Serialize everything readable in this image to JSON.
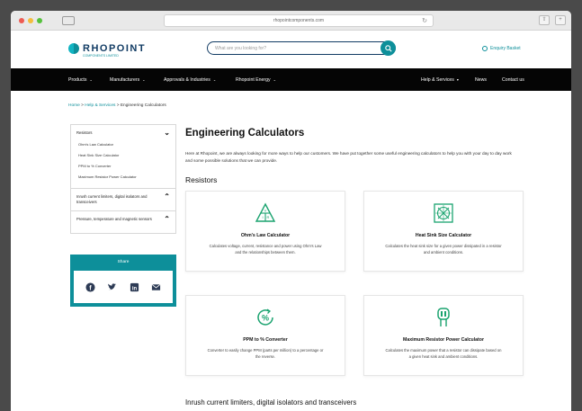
{
  "browser": {
    "url": "rhopointcomponents.com"
  },
  "header": {
    "logo_text": "RHOPOINT",
    "logo_sub": "COMPONENTS LIMITED",
    "search_placeholder": "What are you looking for?",
    "basket_label": "Enquiry Basket"
  },
  "nav": {
    "left": [
      "Products",
      "Manufacturers",
      "Approvals & Industries",
      "Rhopoint Energy"
    ],
    "right_dropdown": "Help & Services",
    "right": [
      "News",
      "Contact us"
    ]
  },
  "breadcrumb": {
    "home": "Home",
    "sep": " > ",
    "help": "Help & Services",
    "current": "Engineering Calculators"
  },
  "sidebar": {
    "resistors_label": "Resistors",
    "resistor_links": [
      "Ohm's Law Calculator",
      "Heat Sink Size Calculator",
      "PPM to % Converter",
      "Maximum Resistor Power Calculator"
    ],
    "sections": [
      "Inrush current limiters, digital isolators and transceivers",
      "Pressure, temperature and magnetic sensors"
    ]
  },
  "share": {
    "title": "Share"
  },
  "main": {
    "title": "Engineering Calculators",
    "intro": "Here at Rhopoint, we are always looking for more ways to help our customers. We have put together some useful engineering calculators to help you with your day to day work and some possible solutions that we can provide.",
    "section_resistors": "Resistors",
    "cards": [
      {
        "title": "Ohm's Law Calculator",
        "desc": "Calculates voltage, current, resistance and power using Ohm's Law and the relationships between them.",
        "icon": "ohms-law-icon"
      },
      {
        "title": "Heat Sink Size Calculator",
        "desc": "Calculates the heat sink size for a given power dissipated in a resistor and ambient conditions.",
        "icon": "heat-sink-icon"
      },
      {
        "title": "PPM to % Converter",
        "desc": "Converter to easily change PPM (parts per million) to a percentage or the reverse.",
        "icon": "percent-converter-icon"
      },
      {
        "title": "Maximum Resistor Power Calculator",
        "desc": "Calculates the maximum power that a resistor can dissipate based on a given heat sink and ambient conditions.",
        "icon": "resistor-power-icon"
      }
    ],
    "section_inrush": "Inrush current limiters, digital isolators and transceivers"
  },
  "colors": {
    "accent": "#0d8f9a",
    "navy": "#123c64",
    "nav_bg": "#050505"
  }
}
